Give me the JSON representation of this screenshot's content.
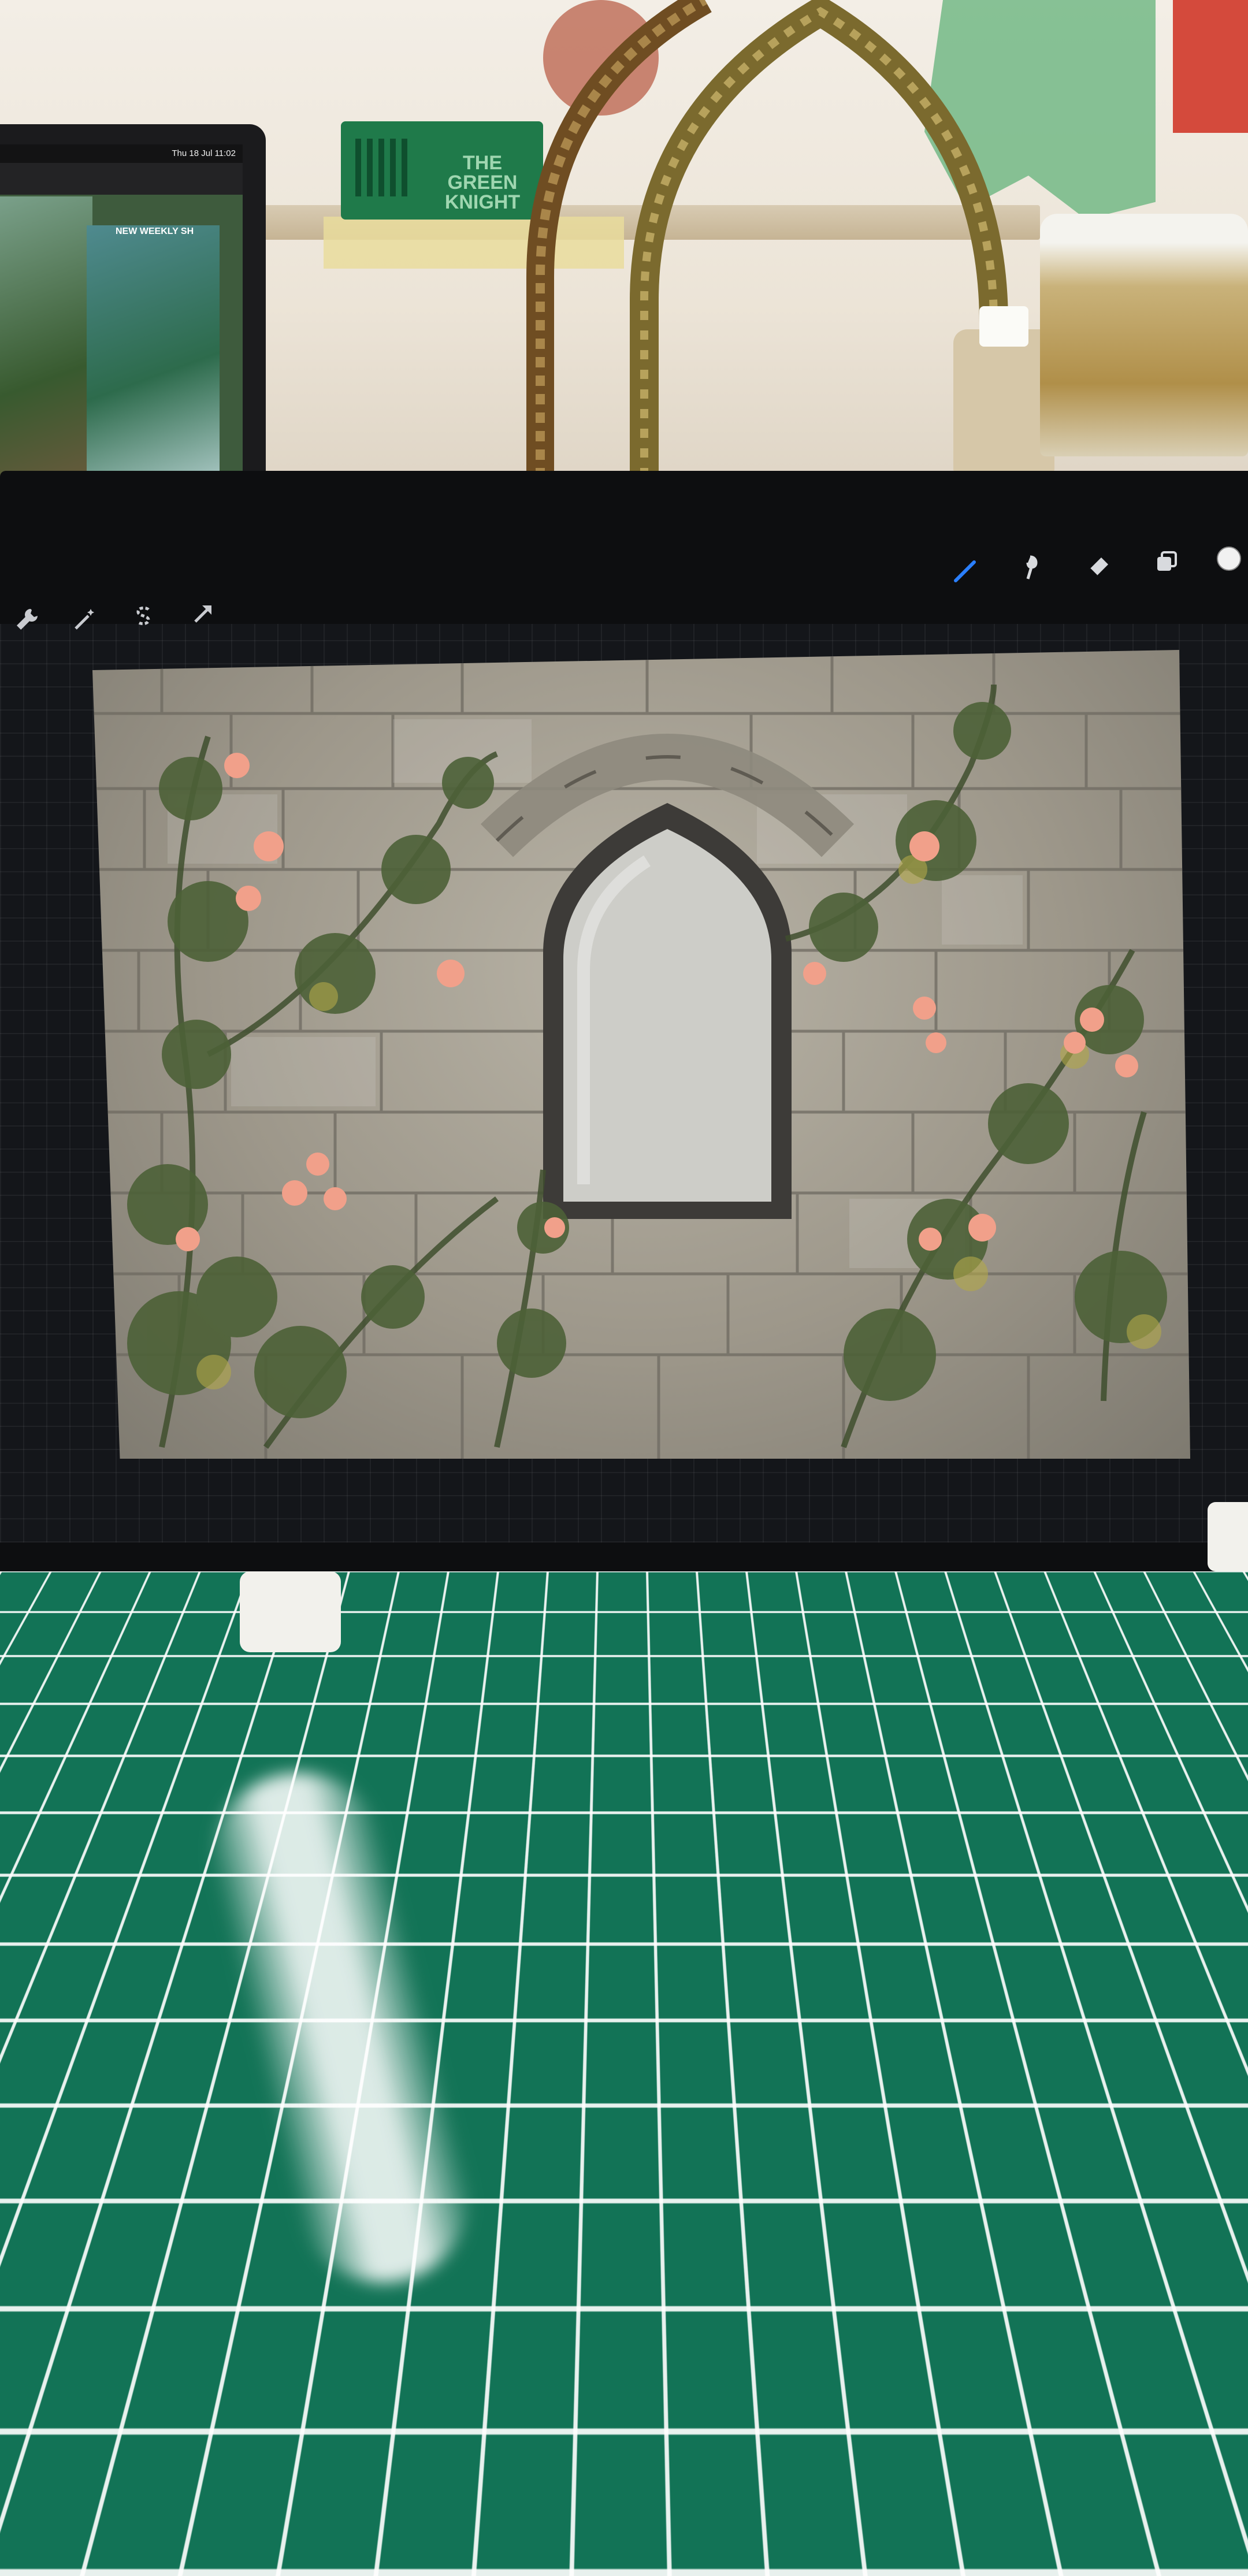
{
  "scene": {
    "description_colors": {
      "wall": "#efe9df",
      "cutting_mat": "#127356",
      "ipad_bezel": "#0d0e10",
      "stone": "#a8a296",
      "vine": "#4d5e38",
      "rose": "#f1a08a",
      "window": "#cfcfcb"
    },
    "green_card": {
      "line1": "THE GREEN",
      "line2": "KNIGHT"
    }
  },
  "laptop": {
    "menubar_time": "Thu 18 Jul  11:02",
    "card_label": "NEW WEEKLY SH"
  },
  "procreate": {
    "left_tools": [
      {
        "name": "actions-wrench-icon"
      },
      {
        "name": "adjustments-wand-icon"
      },
      {
        "name": "selection-s-icon"
      },
      {
        "name": "transform-arrow-icon"
      }
    ],
    "right_tools": [
      {
        "name": "brush-icon",
        "active": true,
        "color": "#2a7fff"
      },
      {
        "name": "smudge-icon"
      },
      {
        "name": "eraser-icon"
      },
      {
        "name": "layers-icon"
      },
      {
        "name": "color-swatch-icon"
      }
    ]
  }
}
